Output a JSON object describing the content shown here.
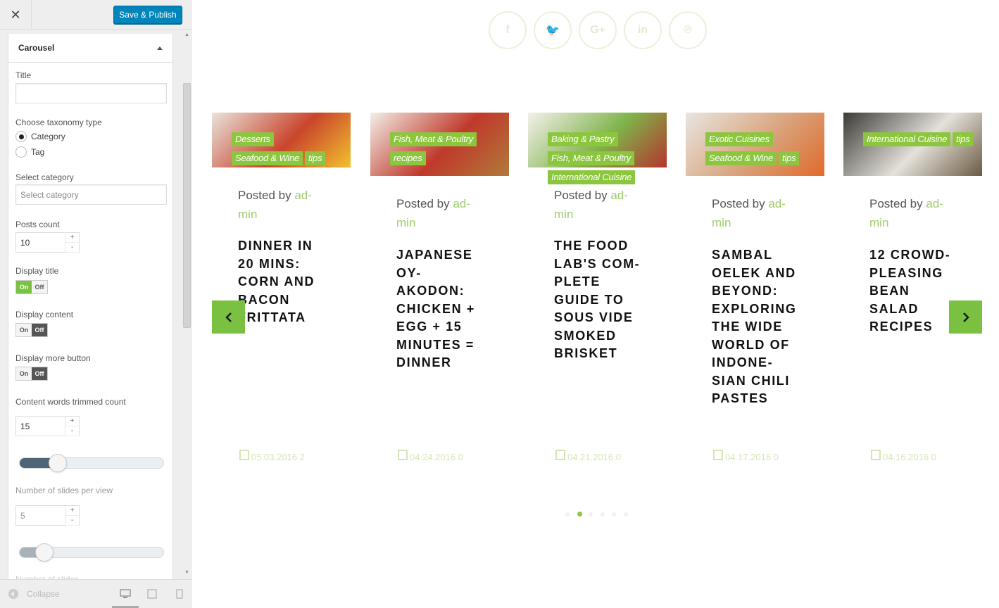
{
  "topbar": {
    "close_label": "✕",
    "save_label": "Save & Publish"
  },
  "panel": {
    "title": "Carousel",
    "title_label": "Title",
    "title_value": "",
    "taxonomy_label": "Choose taxonomy type",
    "taxonomy_options": [
      "Category",
      "Tag"
    ],
    "taxonomy_selected": "Category",
    "category_label": "Select category",
    "category_placeholder": "Select category",
    "posts_count_label": "Posts count",
    "posts_count_value": "10",
    "display_title_label": "Display title",
    "display_title_value": "On",
    "display_content_label": "Display content",
    "display_content_value": "Off",
    "display_more_label": "Display more button",
    "display_more_value": "Off",
    "toggle_on": "On",
    "toggle_off": "Off",
    "trim_label": "Content words trimmed count",
    "trim_value": "15",
    "trim_slider_fraction": 0.26,
    "slides_label": "Number of slides per view",
    "slides_value": "5",
    "slides_slider_fraction": 0.17,
    "next_label_partial": "Number of slides"
  },
  "footer": {
    "collapse_label": "Collapse",
    "devices": [
      "desktop-icon",
      "tablet-icon",
      "mobile-icon"
    ]
  },
  "social_icons": [
    {
      "name": "facebook-icon",
      "glyph": "f"
    },
    {
      "name": "twitter-icon",
      "glyph": "🐦"
    },
    {
      "name": "google-plus-icon",
      "glyph": "G+"
    },
    {
      "name": "linkedin-icon",
      "glyph": "in"
    },
    {
      "name": "pinterest-icon",
      "glyph": "℗"
    }
  ],
  "posted_by": "Posted by",
  "author_line1": "ad-",
  "author_line2": "min",
  "cards": [
    {
      "tags": [
        "Desserts",
        "Seafood & Wine",
        "tips"
      ],
      "title": [
        "DINNER IN",
        "20 MINS:",
        "CORN AND",
        "BACON",
        "FRITTATA"
      ],
      "date": "05.03.2016",
      "comments": "2",
      "img_colors": [
        "#e9e4dd",
        "#c9452c",
        "#f2c12e"
      ]
    },
    {
      "tags": [
        "Fish, Meat & Poultry",
        "recipes"
      ],
      "title": [
        "JAPANESE",
        "OY-",
        "AKODON:",
        "CHICKEN +",
        "EGG + 15",
        "MINUTES =",
        "DINNER"
      ],
      "date": "04.24.2016",
      "comments": "0",
      "img_colors": [
        "#f3efe9",
        "#c0392b",
        "#b07a3a"
      ]
    },
    {
      "tags": [
        "Baking & Pastry",
        "Fish, Meat & Poultry",
        "International Cuisine"
      ],
      "title": [
        "THE FOOD",
        "LAB'S COM-",
        "PLETE",
        "GUIDE TO",
        "SOUS VIDE",
        "SMOKED",
        "BRISKET"
      ],
      "date": "04.21.2016",
      "comments": "0",
      "img_colors": [
        "#f4f1ec",
        "#7fb34a",
        "#b5342c"
      ]
    },
    {
      "tags": [
        "Exotic Cuisines",
        "Seafood & Wine",
        "tips"
      ],
      "title": [
        "SAMBAL",
        "OELEK AND",
        "BEYOND:",
        "EXPLORING",
        "THE WIDE",
        "WORLD OF",
        "INDONE-",
        "SIAN CHILI",
        "PASTES"
      ],
      "date": "04.17.2016",
      "comments": "0",
      "img_colors": [
        "#e8e6e2",
        "#d9a27a",
        "#e06a2c"
      ]
    },
    {
      "tags": [
        "International Cuisine",
        "tips"
      ],
      "title": [
        "12 CROWD-",
        "PLEASING",
        "BEAN",
        "SALAD",
        "RECIPES"
      ],
      "date": "04.16.2016",
      "comments": "0",
      "img_colors": [
        "#3b3a36",
        "#e4e1da",
        "#6b5a43"
      ]
    }
  ],
  "pagination_count": 6,
  "pagination_active": 2
}
